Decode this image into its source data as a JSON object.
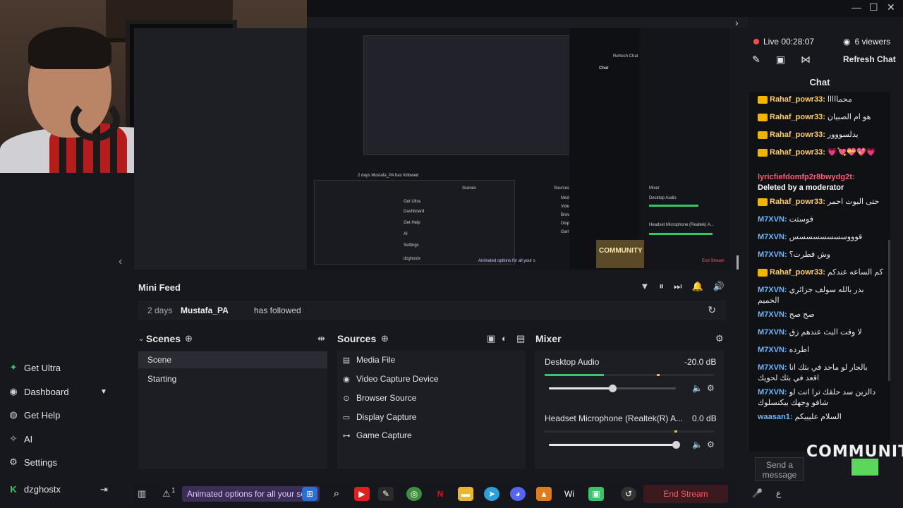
{
  "window": {
    "controls": [
      "—",
      "☐",
      "✕"
    ]
  },
  "preview": {
    "nested_labels": [
      "Chat",
      "Refresh Chat",
      "Scenes",
      "Sources",
      "Mixer",
      "Desktop Audio",
      "Headset Microphone (Realtek) A...",
      "Media File",
      "Video Capture Device",
      "Browser Source",
      "Display Capture",
      "Game Capture",
      "Get Ultra",
      "Dashboard",
      "Get Help",
      "AI",
      "Settings",
      "dzghostx",
      "End Stream",
      "Animated options for all your s"
    ],
    "nested_feed": "2 days  Mustafa_PA has followed",
    "logo_text": "COMMUNITY"
  },
  "nav": {
    "items": [
      {
        "label": "Get Ultra",
        "icon": "ultra-icon"
      },
      {
        "label": "Dashboard",
        "icon": "dashboard-icon"
      },
      {
        "label": "Get Help",
        "icon": "help-icon"
      },
      {
        "label": "AI",
        "icon": "ai-icon"
      },
      {
        "label": "Settings",
        "icon": "gear-icon"
      }
    ],
    "user": "dzghostx"
  },
  "minifeed": {
    "title": "Mini Feed",
    "age": "2 days",
    "user": "Mustafa_PA",
    "action": "has followed"
  },
  "scenes": {
    "title": "Scenes",
    "items": [
      "Scene",
      "Starting"
    ],
    "selected": "Scene"
  },
  "sources": {
    "title": "Sources",
    "items": [
      {
        "label": "Media File",
        "icon": "file-icon"
      },
      {
        "label": "Video Capture Device",
        "icon": "camera-icon"
      },
      {
        "label": "Browser Source",
        "icon": "browser-icon"
      },
      {
        "label": "Display Capture",
        "icon": "monitor-icon"
      },
      {
        "label": "Game Capture",
        "icon": "gamepad-icon"
      }
    ]
  },
  "mixer": {
    "title": "Mixer",
    "channels": [
      {
        "name": "Desktop Audio",
        "db": "-20.0 dB",
        "volume": 0.5
      },
      {
        "name": "Headset Microphone (Realtek(R) A...",
        "db": "0.0 dB",
        "volume": 1.0
      }
    ]
  },
  "taskbar": {
    "tip": "Animated options for all your sc",
    "end_stream": "End Stream",
    "badge": "1",
    "app_text": "Wi"
  },
  "chat": {
    "live": "Live 00:28:07",
    "viewers": "6 viewers",
    "refresh": "Refresh Chat",
    "title": "Chat",
    "send_placeholder": "Send a message",
    "messages": [
      {
        "user": "Rahaf_powr33:",
        "text": "محمااااا",
        "style": "gold"
      },
      {
        "user": "Rahaf_powr33:",
        "text": "هو ام الصبيان",
        "style": "gold"
      },
      {
        "user": "Rahaf_powr33:",
        "text": "يدلسووور",
        "style": "gold"
      },
      {
        "user": "Rahaf_powr33:",
        "text": "💗💘💝💖💗",
        "style": "gold"
      },
      {
        "user": "lyricfiefdomfp2r8bwydg2t:",
        "text": "Deleted by a moderator",
        "style": "red"
      },
      {
        "user": "Rahaf_powr33:",
        "text": "حتى البوت احمر",
        "style": "gold"
      },
      {
        "user": "M7XVN:",
        "text": "قوستت",
        "style": "blue"
      },
      {
        "user": "M7XVN:",
        "text": "قوووسسسسسسسس",
        "style": "blue"
      },
      {
        "user": "M7XVN:",
        "text": "وش فطرت؟",
        "style": "blue"
      },
      {
        "user": "Rahaf_powr33:",
        "text": "كم الساعه عندكم",
        "style": "gold"
      },
      {
        "user": "M7XVN:",
        "text": "بدر بالله سولف جزائري الخميم",
        "style": "blue"
      },
      {
        "user": "M7XVN:",
        "text": "صح صح",
        "style": "blue"
      },
      {
        "user": "M7XVN:",
        "text": "لا وقت البث عندهم زق",
        "style": "blue"
      },
      {
        "user": "M7XVN:",
        "text": "اطرده",
        "style": "blue"
      },
      {
        "user": "M7XVN:",
        "text": "بالجار لو ماحد في بثك انا اقعد في بثك لحويك",
        "style": "blue"
      },
      {
        "user": "M7XVN:",
        "text": "دالزين سد حلقك ترا انت لو شافو وجهك بيكنسلوك",
        "style": "blue"
      },
      {
        "user": "waasan1:",
        "text": "السلام عليييكم",
        "style": "blue"
      }
    ]
  },
  "colors": {
    "accent_green": "#39c46a",
    "live_red": "#ff4a4a",
    "end_stream": "#ff5a5f",
    "gold": "#ffcf66",
    "blue": "#6ab7ff"
  }
}
